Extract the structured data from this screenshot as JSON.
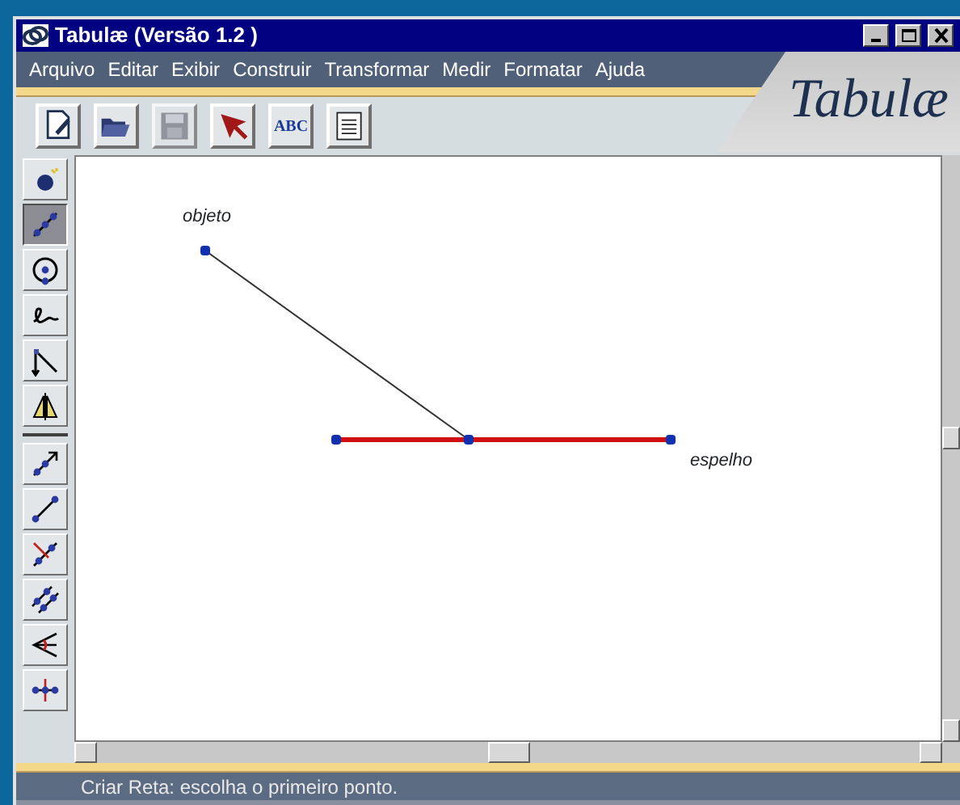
{
  "window": {
    "title": "Tabulæ (Versão 1.2 )"
  },
  "menu": [
    {
      "label": "Arquivo"
    },
    {
      "label": "Editar"
    },
    {
      "label": "Exibir"
    },
    {
      "label": "Construir"
    },
    {
      "label": "Transformar"
    },
    {
      "label": "Medir"
    },
    {
      "label": "Formatar"
    },
    {
      "label": "Ajuda"
    }
  ],
  "logo": {
    "text": "Tabulæ"
  },
  "toolbar": [
    {
      "kind": "new"
    },
    {
      "kind": "open"
    },
    {
      "kind": "save",
      "disabled": true
    },
    {
      "kind": "pointer"
    },
    {
      "kind": "text",
      "label": "ABC"
    },
    {
      "kind": "note"
    }
  ],
  "tools": [
    {
      "kind": "point",
      "selected": false
    },
    {
      "kind": "segment",
      "selected": true
    },
    {
      "kind": "circle",
      "selected": false
    },
    {
      "kind": "freehand",
      "selected": false
    },
    {
      "kind": "perpendicular",
      "selected": false
    },
    {
      "kind": "reflect",
      "selected": false
    },
    {
      "kind": "separator"
    },
    {
      "kind": "ray",
      "selected": false
    },
    {
      "kind": "line",
      "selected": false
    },
    {
      "kind": "perp-line",
      "selected": false
    },
    {
      "kind": "parallel",
      "selected": false
    },
    {
      "kind": "bisector",
      "selected": false
    },
    {
      "kind": "mediator",
      "selected": false
    }
  ],
  "canvas": {
    "labels": [
      {
        "text": "objeto"
      },
      {
        "text": "espelho"
      }
    ]
  },
  "status_bar": {
    "text": "Criar Reta: escolha o primeiro ponto."
  }
}
